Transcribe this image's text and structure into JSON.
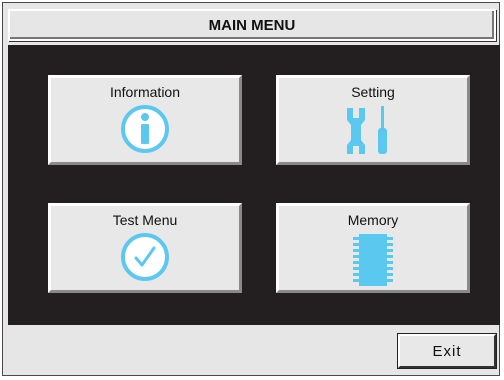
{
  "title": "MAIN MENU",
  "menu": {
    "information": {
      "label": "Information",
      "icon": "info-icon"
    },
    "setting": {
      "label": "Setting",
      "icon": "wrench-screwdriver-icon"
    },
    "test_menu": {
      "label": "Test Menu",
      "icon": "checkmark-icon"
    },
    "memory": {
      "label": "Memory",
      "icon": "memory-chip-icon"
    }
  },
  "exit_label": "Exit",
  "colors": {
    "icon_accent": "#5bc8f0",
    "panel_background": "#231f20",
    "tile_background": "#e8e8e8"
  }
}
